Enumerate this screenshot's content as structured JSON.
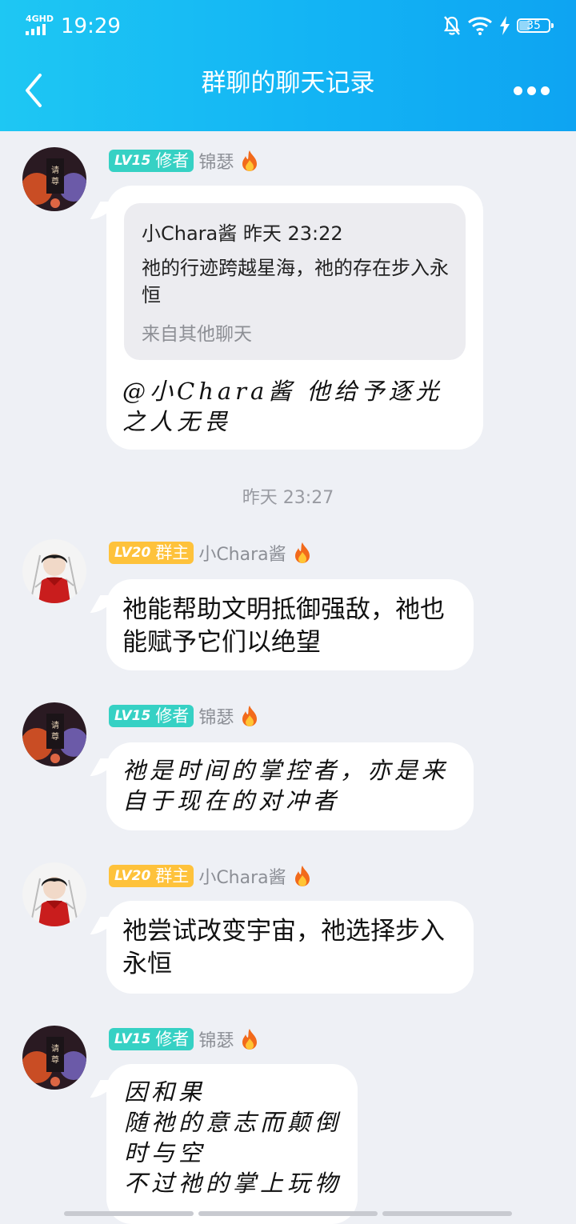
{
  "status_bar": {
    "network": "4GHD",
    "time": "19:29",
    "battery": "35"
  },
  "nav": {
    "title": "群聊的聊天记录"
  },
  "timestamp_divider": "昨天 23:27",
  "messages": [
    {
      "level": "LV15",
      "role": "修者",
      "sender": "锦瑟",
      "quote": {
        "header": "小Chara酱 昨天 23:22",
        "text": "祂的行迹跨越星海，祂的存在步入永恒",
        "source": "来自其他聊天"
      },
      "text": "@小Chara酱 他给予逐光之人无畏"
    },
    {
      "level": "LV20",
      "role": "群主",
      "sender": "小Chara酱",
      "text": "祂能帮助文明抵御强敌，祂也能赋予它们以绝望"
    },
    {
      "level": "LV15",
      "role": "修者",
      "sender": "锦瑟",
      "text": "祂是时间的掌控者，亦是来自于现在的对冲者"
    },
    {
      "level": "LV20",
      "role": "群主",
      "sender": "小Chara酱",
      "text": "祂尝试改变宇宙，祂选择步入永恒"
    },
    {
      "level": "LV15",
      "role": "修者",
      "sender": "锦瑟",
      "lines": [
        "因和果",
        "随祂的意志而颠倒",
        "时与空",
        "不过祂的掌上玩物"
      ]
    }
  ],
  "colors": {
    "header_gradient": [
      "#1ec7f3",
      "#0ea4f2"
    ],
    "badge_member": "#36d1c4",
    "badge_owner": "#fec23b",
    "background": "#eef0f5"
  }
}
